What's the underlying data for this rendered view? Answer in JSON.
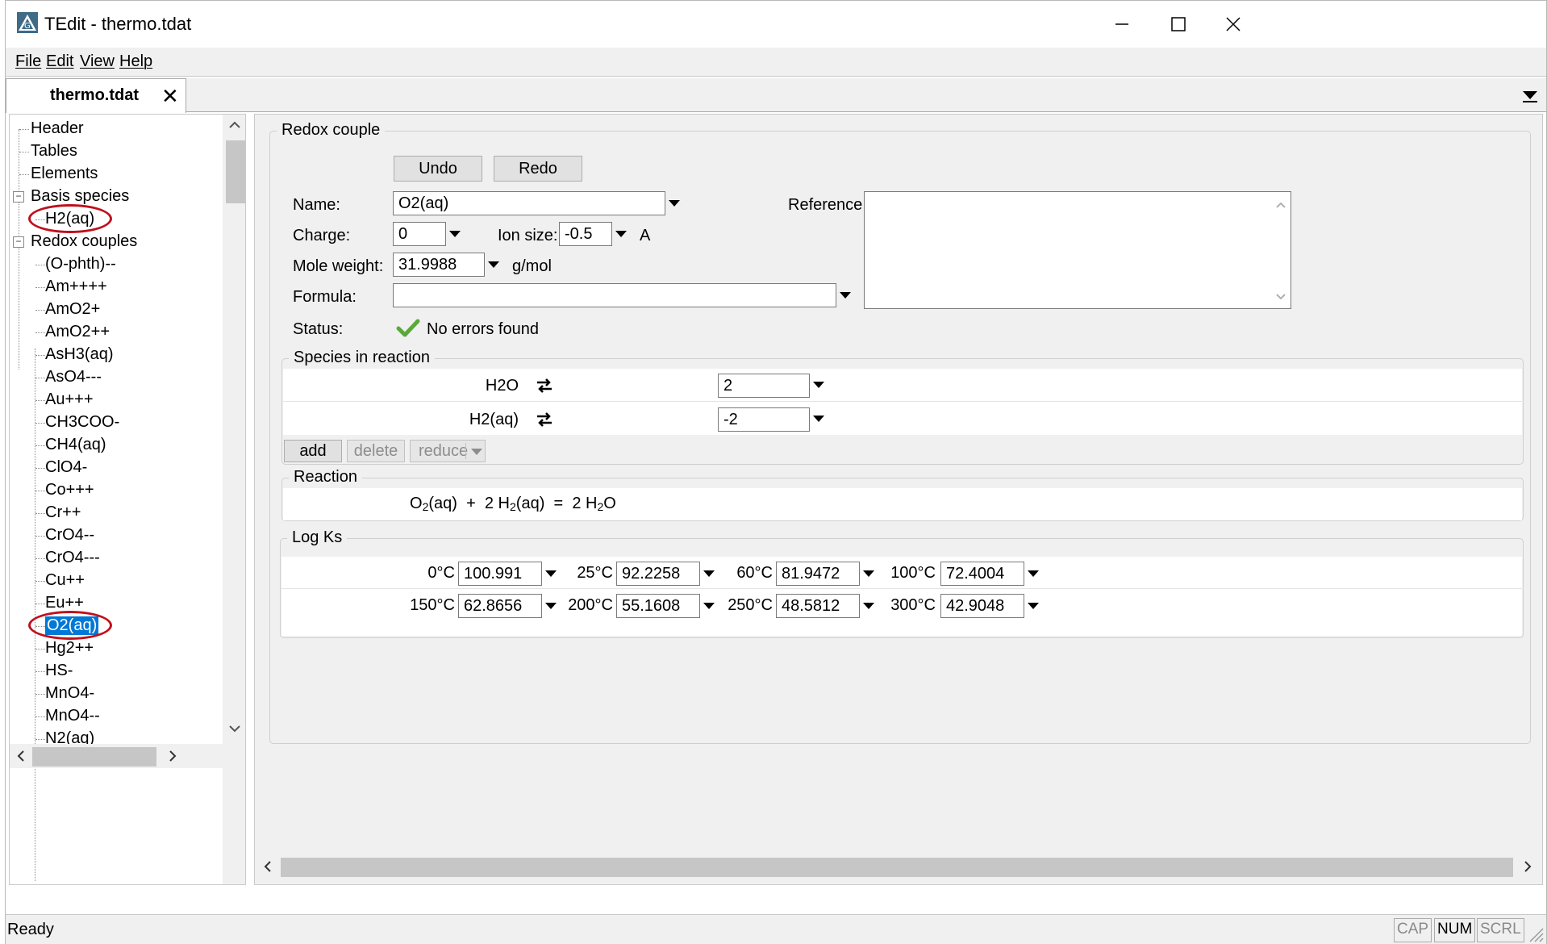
{
  "window": {
    "title": "TEdit - thermo.tdat",
    "minimize_icon": "minimize-icon",
    "maximize_icon": "maximize-icon",
    "close_icon": "close-icon"
  },
  "menu": [
    "File",
    "Edit",
    "View",
    "Help"
  ],
  "tab": {
    "label": "thermo.tdat",
    "close": "✕"
  },
  "tree": {
    "top_items": [
      "Header",
      "Tables",
      "Elements"
    ],
    "basis_species": {
      "label": "Basis species",
      "children": [
        "H2(aq)"
      ]
    },
    "redox_couples": {
      "label": "Redox couples",
      "children": [
        "(O-phth)--",
        "Am++++",
        "AmO2+",
        "AmO2++",
        "AsH3(aq)",
        "AsO4---",
        "Au+++",
        "CH3COO-",
        "CH4(aq)",
        "ClO4-",
        "Co+++",
        "Cr++",
        "CrO4--",
        "CrO4---",
        "Cu++",
        "Eu++",
        "O2(aq)",
        "Hg2++",
        "HS-",
        "MnO4-",
        "MnO4--",
        "N2(aq)"
      ],
      "selected": "O2(aq)"
    }
  },
  "form": {
    "group_title": "Redox couple",
    "undo": "Undo",
    "redo": "Redo",
    "name_label": "Name:",
    "name_value": "O2(aq)",
    "reference_label": "Reference:",
    "charge_label": "Charge:",
    "charge_value": "0",
    "ion_size_label": "Ion size:",
    "ion_size_value": "-0.5",
    "ion_size_unit": "A",
    "mole_weight_label": "Mole weight:",
    "mole_weight_value": "31.9988",
    "mole_weight_unit": "g/mol",
    "formula_label": "Formula:",
    "formula_value": "",
    "status_label": "Status:",
    "status_value": "No errors found"
  },
  "species": {
    "group_title": "Species in reaction",
    "rows": [
      {
        "name": "H2O",
        "coef": "2"
      },
      {
        "name": "H2(aq)",
        "coef": "-2"
      }
    ],
    "add": "add",
    "delete": "delete",
    "reduce": "reduce"
  },
  "reaction": {
    "group_title": "Reaction",
    "lhs1": "O",
    "lhs1_sub": "2",
    "lhs1_suffix": "(aq)",
    "plus": "+",
    "lhs2": "2 H",
    "lhs2_sub": "2",
    "lhs2_suffix": "(aq)",
    "eq": "=",
    "rhs": "2 H",
    "rhs_sub": "2",
    "rhs_suffix": "O"
  },
  "logks": {
    "group_title": "Log Ks",
    "entries": [
      {
        "temp": "0°C",
        "value": "100.991"
      },
      {
        "temp": "25°C",
        "value": "92.2258"
      },
      {
        "temp": "60°C",
        "value": "81.9472"
      },
      {
        "temp": "100°C",
        "value": "72.4004"
      },
      {
        "temp": "150°C",
        "value": "62.8656"
      },
      {
        "temp": "200°C",
        "value": "55.1608"
      },
      {
        "temp": "250°C",
        "value": "48.5812"
      },
      {
        "temp": "300°C",
        "value": "42.9048"
      }
    ]
  },
  "status": {
    "text": "Ready",
    "indicators": [
      {
        "label": "CAP",
        "on": false
      },
      {
        "label": "NUM",
        "on": true
      },
      {
        "label": "SCRL",
        "on": false
      }
    ]
  },
  "colors": {
    "selection": "#0078d7",
    "annotation": "#c0101d",
    "check": "#5aa83a"
  }
}
